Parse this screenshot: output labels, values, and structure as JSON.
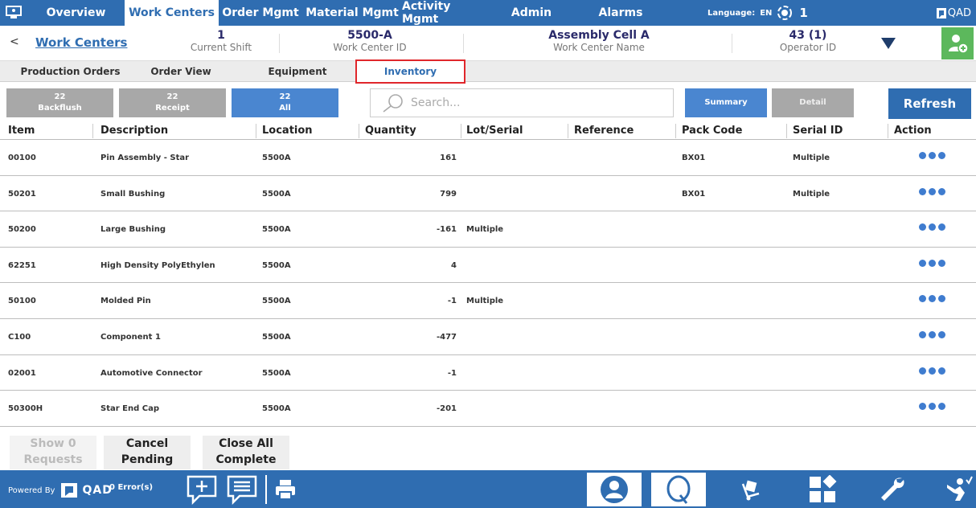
{
  "nav": {
    "tabs": [
      "Overview",
      "Work Centers",
      "Order Mgmt",
      "Material Mgmt",
      "Activity Mgmt",
      "Admin",
      "Alarms"
    ],
    "active_tab": "Work Centers",
    "language_label": "Language:",
    "language_value": "EN",
    "alarm_count": "1",
    "brand": "QAD"
  },
  "header": {
    "back": "<",
    "link": "Work Centers",
    "shift_value": "1",
    "shift_label": "Current Shift",
    "wc_id_value": "5500-A",
    "wc_id_label": "Work Center ID",
    "wc_name_value": "Assembly Cell A",
    "wc_name_label": "Work Center Name",
    "operator_value": "43 (1)",
    "operator_label": "Operator ID"
  },
  "subtabs": [
    "Production Orders",
    "Order View",
    "Equipment",
    "Inventory"
  ],
  "active_subtab": "Inventory",
  "filters": {
    "backflush_count": "22",
    "backflush_label": "Backflush",
    "receipt_count": "22",
    "receipt_label": "Receipt",
    "all_count": "22",
    "all_label": "All",
    "search_placeholder": "Search...",
    "summary_label": "Summary",
    "detail_label": "Detail",
    "refresh_label": "Refresh"
  },
  "table": {
    "columns": [
      "Item",
      "Description",
      "Location",
      "Quantity",
      "Lot/Serial",
      "Reference",
      "Pack Code",
      "Serial ID",
      "Action"
    ],
    "rows": [
      {
        "item": "00100",
        "description": "Pin Assembly - Star",
        "location": "5500A",
        "quantity": "161",
        "lot": "",
        "reference": "",
        "pack": "BX01",
        "serial": "Multiple"
      },
      {
        "item": "50201",
        "description": "Small Bushing",
        "location": "5500A",
        "quantity": "799",
        "lot": "",
        "reference": "",
        "pack": "BX01",
        "serial": "Multiple"
      },
      {
        "item": "50200",
        "description": "Large Bushing",
        "location": "5500A",
        "quantity": "-161",
        "lot": "Multiple",
        "reference": "",
        "pack": "",
        "serial": ""
      },
      {
        "item": "62251",
        "description": "High Density PolyEthylen",
        "location": "5500A",
        "quantity": "4",
        "lot": "",
        "reference": "",
        "pack": "",
        "serial": ""
      },
      {
        "item": "50100",
        "description": "Molded Pin",
        "location": "5500A",
        "quantity": "-1",
        "lot": "Multiple",
        "reference": "",
        "pack": "",
        "serial": ""
      },
      {
        "item": "C100",
        "description": "Component 1",
        "location": "5500A",
        "quantity": "-477",
        "lot": "",
        "reference": "",
        "pack": "",
        "serial": ""
      },
      {
        "item": "02001",
        "description": "Automotive Connector",
        "location": "5500A",
        "quantity": "-1",
        "lot": "",
        "reference": "",
        "pack": "",
        "serial": ""
      },
      {
        "item": "50300H",
        "description": "Star End Cap",
        "location": "5500A",
        "quantity": "-201",
        "lot": "",
        "reference": "",
        "pack": "",
        "serial": ""
      }
    ]
  },
  "actions": {
    "show_requests_l1": "Show 0",
    "show_requests_l2": "Requests",
    "cancel_l1": "Cancel",
    "cancel_l2": "Pending",
    "close_l1": "Close All",
    "close_l2": "Complete"
  },
  "footer": {
    "powered_by": "Powered By",
    "brand": "QAD",
    "errors": "0 Error(s)"
  },
  "colors": {
    "primary": "#2f6db1",
    "accent_blue": "#4a86d0",
    "grey_button": "#a8a8a8",
    "highlight_red": "#e0262b",
    "operator_green": "#5cb85c"
  }
}
